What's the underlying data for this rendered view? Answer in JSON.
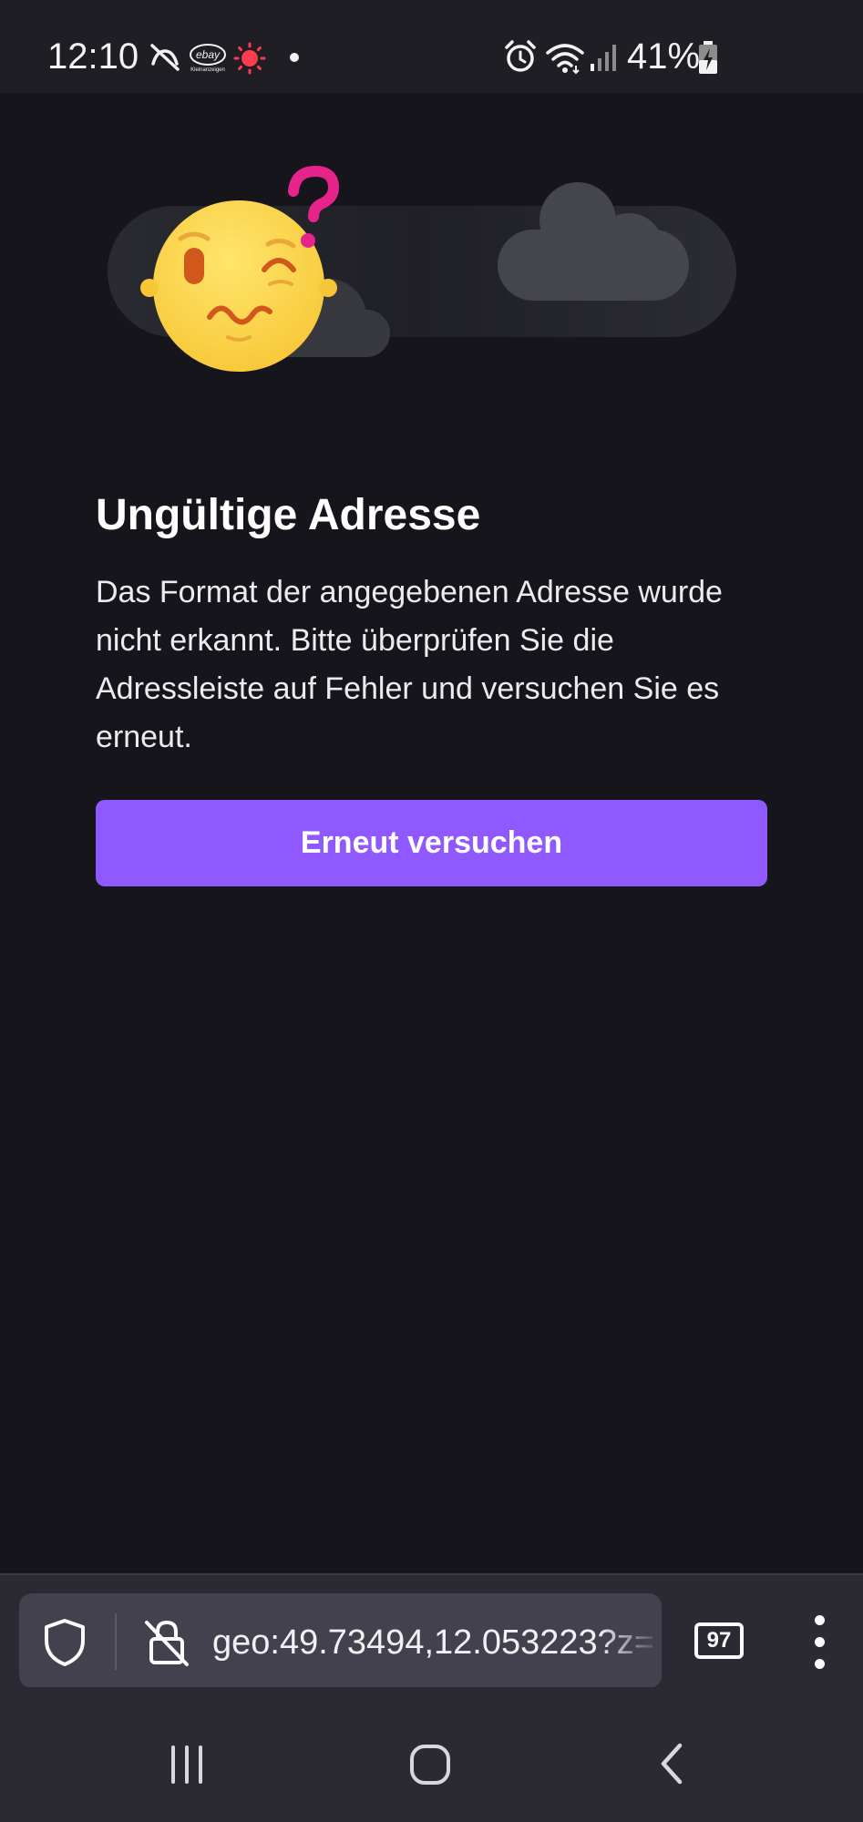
{
  "status_bar": {
    "time": "12:10",
    "battery_percent": "41%",
    "icons": [
      "notifications-off-icon",
      "ebay-kleinanzeigen-icon",
      "recording-icon",
      "dot-icon",
      "alarm-icon",
      "wifi-icon",
      "signal-icon",
      "battery-charging-icon"
    ],
    "ebay_logo_text": "ebay",
    "ebay_logo_subtext": "Kleinanzeigen"
  },
  "error": {
    "illustration": "confused-face-clouds",
    "title": "Ungültige Adresse",
    "message": "Das Format der angegebenen Adresse wurde nicht erkannt. Bitte überprüfen Sie die Adressleiste auf Fehler und versuchen Sie es erneut.",
    "retry_label": "Erneut versuchen"
  },
  "toolbar": {
    "url": "geo:49.73494,12.053223?z=",
    "tab_count": "97",
    "icons": [
      "shield-icon",
      "insecure-lock-icon",
      "menu-icon"
    ]
  },
  "nav_bar": {
    "icons": [
      "recents-icon",
      "home-icon",
      "back-icon"
    ]
  },
  "colors": {
    "background": "#16151c",
    "toolbar": "#2b2a33",
    "url_field": "#42414d",
    "accent": "#9059ff",
    "face": "#ffd84d",
    "question_mark": "#e7238c"
  }
}
